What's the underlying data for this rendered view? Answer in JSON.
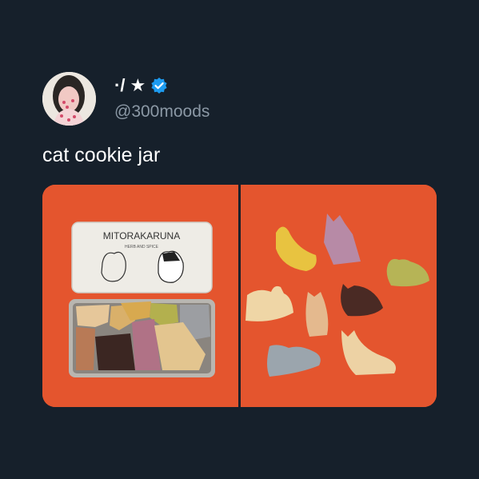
{
  "author": {
    "display_name": "·/ ★",
    "handle": "@300moods",
    "verified": true,
    "avatar_icon": "avatar-photo",
    "verified_icon": "verified-badge-icon",
    "verified_color": "#1d9bf0"
  },
  "tweet": {
    "text": "cat cookie jar"
  },
  "media": {
    "photo_count": 2,
    "tin_lid_text": "MITORAKARUNA",
    "tin_subtitle": "HERB AND SPICE",
    "background_color": "#e4552e"
  }
}
